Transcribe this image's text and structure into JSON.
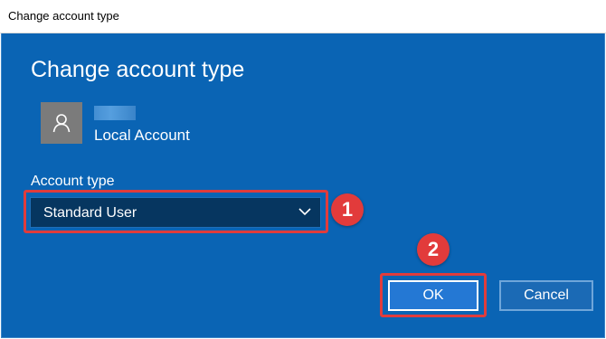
{
  "window": {
    "title": "Change account type"
  },
  "dialog": {
    "heading": "Change account type",
    "account": {
      "avatar_icon": "user-icon",
      "subtitle": "Local Account"
    },
    "account_type": {
      "label": "Account type",
      "selected_value": "Standard User"
    },
    "buttons": {
      "ok": "OK",
      "cancel": "Cancel"
    }
  },
  "annotations": {
    "step1": "1",
    "step2": "2"
  },
  "colors": {
    "dialog_background": "#0a64b4",
    "select_background": "#063660",
    "annotation_red": "#e03c3c"
  }
}
